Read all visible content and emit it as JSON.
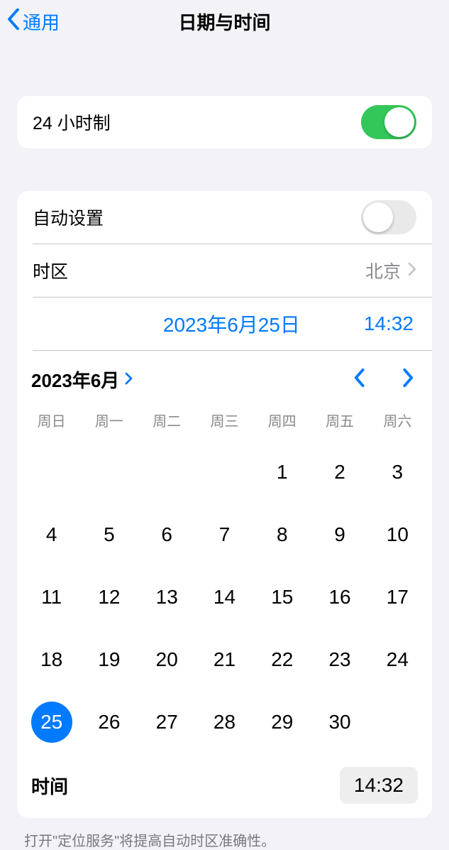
{
  "header": {
    "back_label": "通用",
    "title": "日期与时间"
  },
  "settings": {
    "time_24h_label": "24 小时制",
    "time_24h_on": true,
    "auto_set_label": "自动设置",
    "auto_set_on": false,
    "timezone_label": "时区",
    "timezone_value": "北京",
    "selected_date_display": "2023年6月25日",
    "selected_time_display": "14:32"
  },
  "calendar": {
    "month_title": "2023年6月",
    "weekdays": [
      "周日",
      "周一",
      "周二",
      "周三",
      "周四",
      "周五",
      "周六"
    ],
    "leading_blanks": 4,
    "days": [
      1,
      2,
      3,
      4,
      5,
      6,
      7,
      8,
      9,
      10,
      11,
      12,
      13,
      14,
      15,
      16,
      17,
      18,
      19,
      20,
      21,
      22,
      23,
      24,
      25,
      26,
      27,
      28,
      29,
      30
    ],
    "selected_day": 25,
    "time_label": "时间",
    "time_value": "14:32"
  },
  "footer_note": "打开\"定位服务\"将提高自动时区准确性。"
}
